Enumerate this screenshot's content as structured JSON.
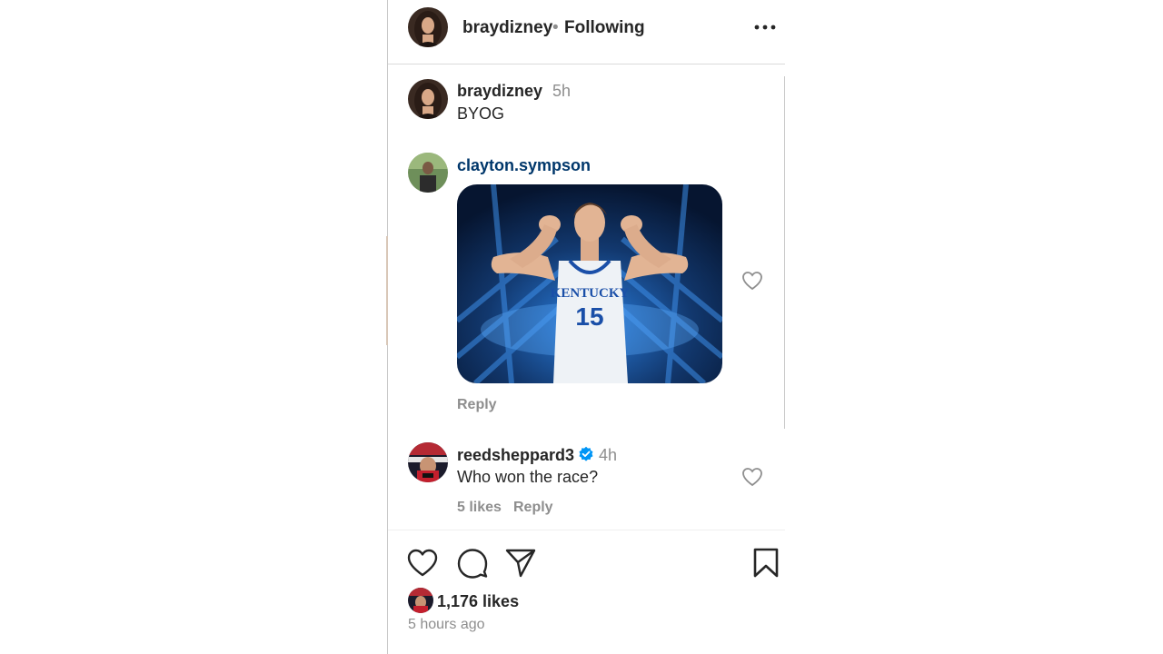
{
  "header": {
    "username": "braydizney",
    "separator": "•",
    "follow_status": "Following",
    "more_icon": "more-horizontal-icon"
  },
  "comments": [
    {
      "username": "braydizney",
      "time": "5h",
      "text": "BYOG"
    },
    {
      "username": "clayton.sympson",
      "gif": {
        "jersey_team": "KENTUCKY",
        "jersey_number": "15"
      },
      "reply_label": "Reply"
    },
    {
      "username": "reedsheppard3",
      "verified": true,
      "time": "4h",
      "text": "Who won the race?",
      "likes": "5 likes",
      "reply_label": "Reply"
    }
  ],
  "actions": {
    "like_icon": "heart-icon",
    "comment_icon": "comment-icon",
    "share_icon": "send-icon",
    "save_icon": "bookmark-icon"
  },
  "post": {
    "likes": "1,176 likes",
    "time_ago": "5 hours ago"
  },
  "colors": {
    "text": "#262626",
    "muted": "#8e8e8e",
    "link_user": "#00376b",
    "verified": "#0095f6"
  }
}
